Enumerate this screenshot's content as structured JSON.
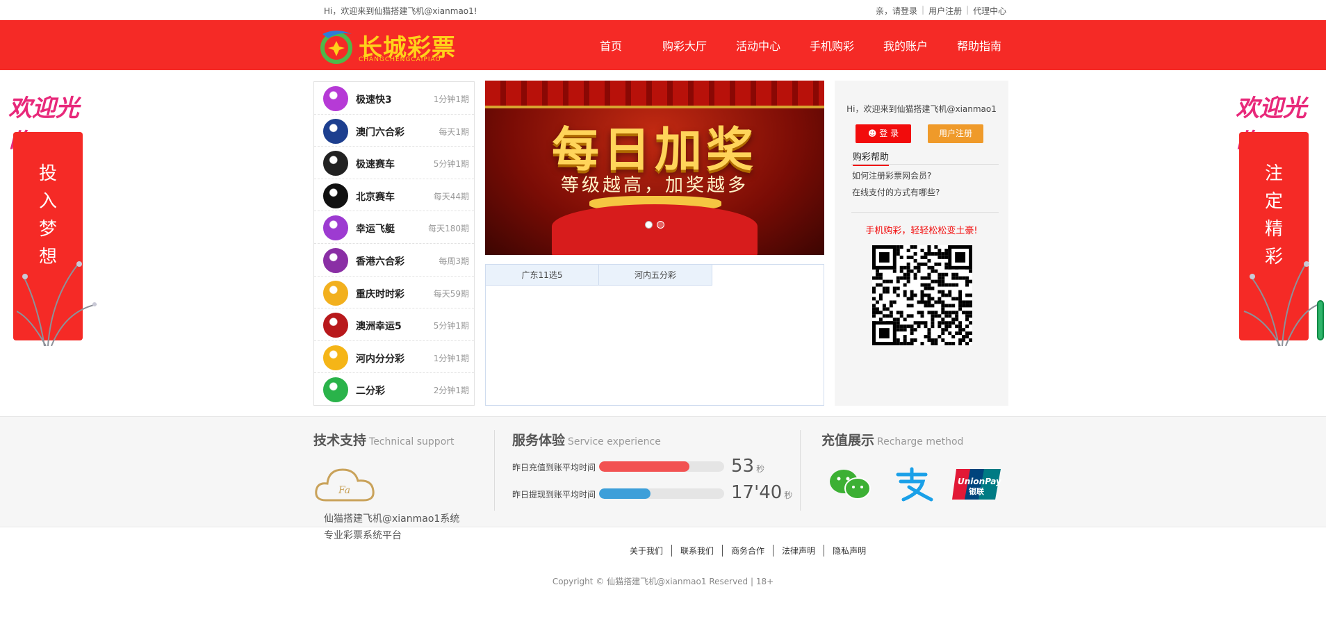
{
  "topbar": {
    "welcome": "Hi，欢迎来到仙猫搭建飞机@xianmao1!",
    "links": [
      "亲，请登录",
      "用户注册",
      "代理中心"
    ]
  },
  "header": {
    "logo_text": "长城彩票",
    "logo_sub": "CHANGCHENGCAIPIAO",
    "nav": [
      "首页",
      "购彩大厅",
      "活动中心",
      "手机购彩",
      "我的账户",
      "帮助指南"
    ]
  },
  "side_left": {
    "welcome_art": "欢迎光临",
    "chars": [
      "投",
      "入",
      "梦",
      "想"
    ]
  },
  "side_right": {
    "welcome_art": "欢迎光临",
    "chars": [
      "注",
      "定",
      "精",
      "彩"
    ]
  },
  "lotteries": [
    {
      "name": "极速快3",
      "freq": "1分钟1期",
      "color": "#b63ad6"
    },
    {
      "name": "澳门六合彩",
      "freq": "每天1期",
      "color": "#1d3f8f"
    },
    {
      "name": "极速赛车",
      "freq": "5分钟1期",
      "color": "#222222"
    },
    {
      "name": "北京赛车",
      "freq": "每天44期",
      "color": "#111111"
    },
    {
      "name": "幸运飞艇",
      "freq": "每天180期",
      "color": "#9d3bd1"
    },
    {
      "name": "香港六合彩",
      "freq": "每周3期",
      "color": "#8a2fa5"
    },
    {
      "name": "重庆时时彩",
      "freq": "每天59期",
      "color": "#f2b01e"
    },
    {
      "name": "澳洲幸运5",
      "freq": "5分钟1期",
      "color": "#b8191c"
    },
    {
      "name": "河内分分彩",
      "freq": "1分钟1期",
      "color": "#f5b517"
    },
    {
      "name": "二分彩",
      "freq": "2分钟1期",
      "color": "#2ab34a"
    }
  ],
  "banner": {
    "title": "每日加奖",
    "subtitle": "等级越高，加奖越多"
  },
  "tabs": [
    "广东11选5",
    "河内五分彩"
  ],
  "panel": {
    "hello": "Hi，欢迎来到仙猫搭建飞机@xianmao1",
    "login": "登 录",
    "register": "用户注册",
    "help_title": "购彩帮助",
    "help_links": [
      "如何注册彩票网会员?",
      "在线支付的方式有哪些?"
    ],
    "mobile_slogan": "手机购彩，轻轻松松变土豪!"
  },
  "footer": {
    "tech_title": "技术支持",
    "tech_title_en": "Technical support",
    "tech_lines": [
      "仙猫搭建飞机@xianmao1系统",
      "专业彩票系统平台"
    ],
    "service_title": "服务体验",
    "service_title_en": "Service experience",
    "stats": [
      {
        "label": "昨日充值到账平均时间",
        "value": "53",
        "unit": "秒",
        "fill": 0.72,
        "color": "#f25252"
      },
      {
        "label": "昨日提现到账平均时间",
        "value": "17'40",
        "unit": "秒",
        "fill": 0.41,
        "color": "#3d9fd9"
      }
    ],
    "recharge_title": "充值展示",
    "recharge_title_en": "Recharge method",
    "payment_icons": [
      "wechat-pay-icon",
      "alipay-icon",
      "unionpay-icon"
    ]
  },
  "bottom": {
    "links": [
      "关于我们",
      "联系我们",
      "商务合作",
      "法律声明",
      "隐私声明"
    ],
    "copyright": "Copyright © 仙猫搭建飞机@xianmao1 Reserved | 18+"
  }
}
